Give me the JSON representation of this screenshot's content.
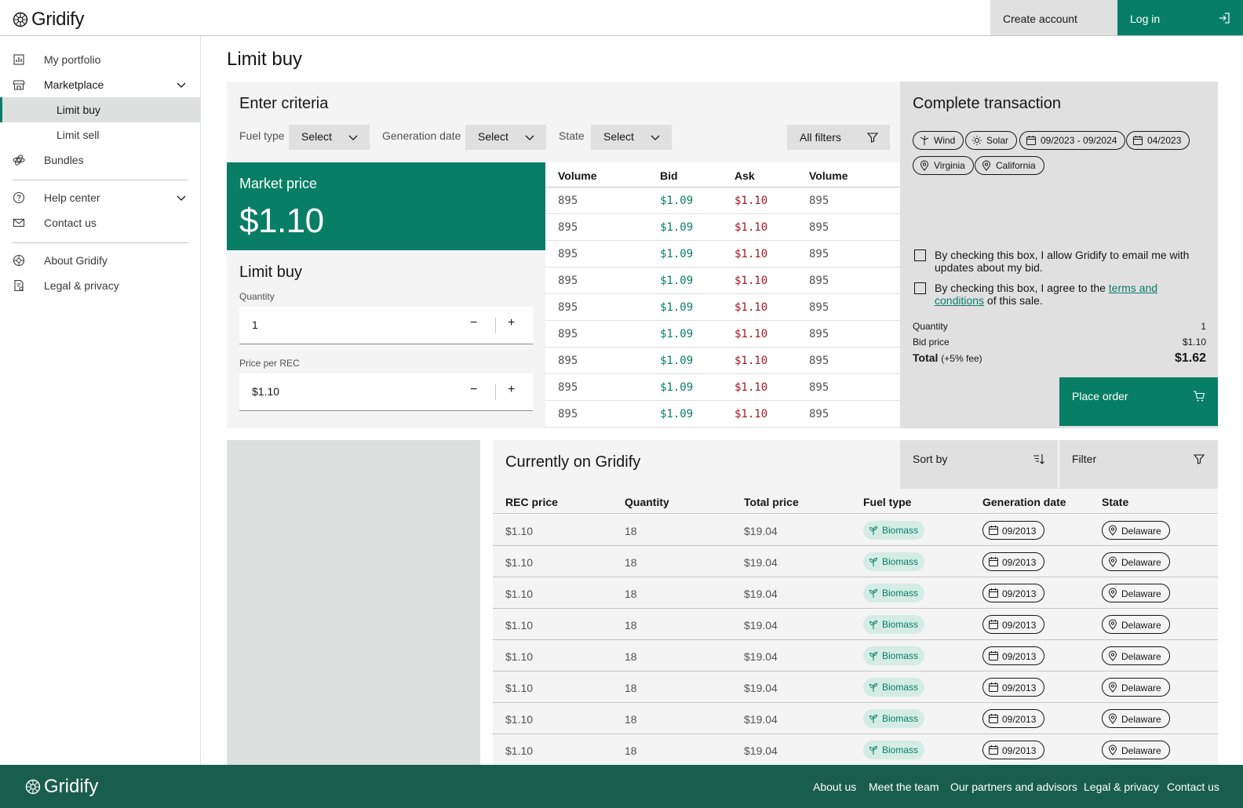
{
  "header": {
    "logo": "Gridify",
    "create_account": "Create account",
    "login": "Log in"
  },
  "sidebar": {
    "items": [
      {
        "label": "My portfolio",
        "icon": "portfolio-icon"
      },
      {
        "label": "Marketplace",
        "icon": "store-icon"
      },
      {
        "label": "Limit buy"
      },
      {
        "label": "Limit sell"
      },
      {
        "label": "Bundles",
        "icon": "bundles-icon"
      },
      {
        "label": "Help center",
        "icon": "help-icon"
      },
      {
        "label": "Contact us",
        "icon": "mail-icon"
      },
      {
        "label": "About Gridify",
        "icon": "about-icon"
      },
      {
        "label": "Legal & privacy",
        "icon": "legal-icon"
      }
    ]
  },
  "page": {
    "title": "Limit buy"
  },
  "criteria": {
    "heading": "Enter criteria",
    "fuel_label": "Fuel type",
    "fuel_value": "Select",
    "gen_label": "Generation date",
    "gen_value": "Select",
    "state_label": "State",
    "state_value": "Select",
    "all_filters": "All filters"
  },
  "market": {
    "label": "Market price",
    "value": "$1.10"
  },
  "limit": {
    "heading": "Limit buy",
    "quantity_label": "Quantity",
    "quantity_value": "1",
    "price_label": "Price per REC",
    "price_value": "$1.10",
    "minus": "−",
    "plus": "+"
  },
  "orderbook": {
    "headers": [
      "Volume",
      "Bid",
      "Ask",
      "Volume"
    ],
    "rows": [
      [
        "895",
        "$1.09",
        "$1.10",
        "895"
      ],
      [
        "895",
        "$1.09",
        "$1.10",
        "895"
      ],
      [
        "895",
        "$1.09",
        "$1.10",
        "895"
      ],
      [
        "895",
        "$1.09",
        "$1.10",
        "895"
      ],
      [
        "895",
        "$1.09",
        "$1.10",
        "895"
      ],
      [
        "895",
        "$1.09",
        "$1.10",
        "895"
      ],
      [
        "895",
        "$1.09",
        "$1.10",
        "895"
      ],
      [
        "895",
        "$1.09",
        "$1.10",
        "895"
      ],
      [
        "895",
        "$1.09",
        "$1.10",
        "895"
      ]
    ]
  },
  "transaction": {
    "heading": "Complete transaction",
    "tags": [
      "Wind",
      "Solar",
      "09/2023 - 09/2024",
      "04/2023",
      "Virginia",
      "California"
    ],
    "consent1": "By checking this box, I allow Gridify to email me with updates about my bid.",
    "consent2_pre": "By checking this box, I agree to the ",
    "consent2_link": "terms and conditions",
    "consent2_post": " of this sale.",
    "quantity_label": "Quantity",
    "quantity_value": "1",
    "bid_label": "Bid price",
    "bid_value": "$1.10",
    "total_label": "Total",
    "total_fee": "(+5% fee)",
    "total_value": "$1.62",
    "place_order": "Place order"
  },
  "current": {
    "heading": "Currently on Gridify",
    "sort_by": "Sort by",
    "filter": "Filter",
    "headers": [
      "REC price",
      "Quantity",
      "Total price",
      "Fuel type",
      "Generation date",
      "State"
    ],
    "rows": [
      [
        "$1.10",
        "18",
        "$19.04",
        "Biomass",
        "09/2013",
        "Delaware"
      ],
      [
        "$1.10",
        "18",
        "$19.04",
        "Biomass",
        "09/2013",
        "Delaware"
      ],
      [
        "$1.10",
        "18",
        "$19.04",
        "Biomass",
        "09/2013",
        "Delaware"
      ],
      [
        "$1.10",
        "18",
        "$19.04",
        "Biomass",
        "09/2013",
        "Delaware"
      ],
      [
        "$1.10",
        "18",
        "$19.04",
        "Biomass",
        "09/2013",
        "Delaware"
      ],
      [
        "$1.10",
        "18",
        "$19.04",
        "Biomass",
        "09/2013",
        "Delaware"
      ],
      [
        "$1.10",
        "18",
        "$19.04",
        "Biomass",
        "09/2013",
        "Delaware"
      ],
      [
        "$1.10",
        "18",
        "$19.04",
        "Biomass",
        "09/2013",
        "Delaware"
      ]
    ]
  },
  "footer": {
    "logo": "Gridify",
    "links": [
      "About us",
      "Meet the team",
      "Our partners and advisors",
      "Legal & privacy",
      "Contact us"
    ]
  },
  "colors": {
    "brand": "#087e66",
    "footer": "#195e4c",
    "ask": "#a2191f"
  }
}
